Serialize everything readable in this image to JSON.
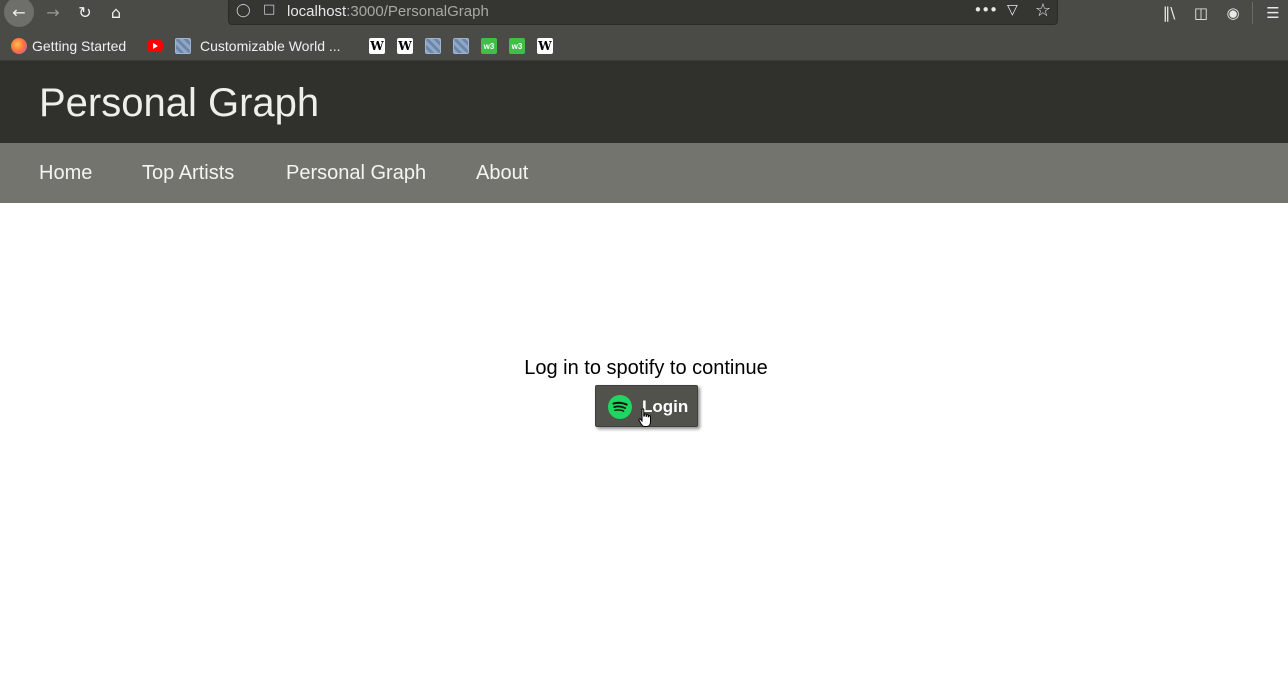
{
  "browser": {
    "url_host": "localhost",
    "url_path": ":3000/PersonalGraph",
    "more_icon": "ellipsis-icon",
    "bookmarks": [
      {
        "label": "Getting Started",
        "icon": "firefox-icon"
      },
      {
        "label": "",
        "icon": "youtube-icon"
      },
      {
        "label": "Customizable World ...",
        "icon": "globe-icon"
      },
      {
        "label": "",
        "icon": "wikipedia-icon"
      },
      {
        "label": "",
        "icon": "wikipedia-icon"
      },
      {
        "label": "",
        "icon": "globe-icon"
      },
      {
        "label": "",
        "icon": "globe-icon"
      },
      {
        "label": "",
        "icon": "w3schools-icon"
      },
      {
        "label": "",
        "icon": "w3schools-icon"
      },
      {
        "label": "",
        "icon": "wikipedia-icon"
      }
    ]
  },
  "header": {
    "title": "Personal Graph"
  },
  "nav": {
    "items": [
      "Home",
      "Top Artists",
      "Personal Graph",
      "About"
    ]
  },
  "main": {
    "prompt": "Log in to spotify to continue",
    "login_label": "Login",
    "login_icon": "spotify-icon"
  },
  "colors": {
    "header_bg": "#30302c",
    "nav_bg": "#74746f",
    "button_bg": "#52524d",
    "spotify_green": "#1ed760"
  }
}
